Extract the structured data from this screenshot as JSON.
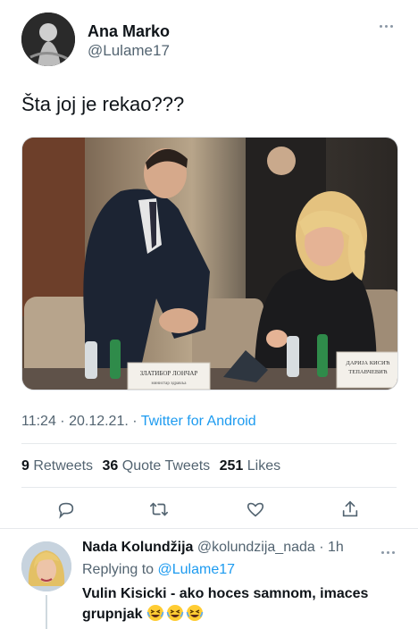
{
  "tweet": {
    "author": {
      "display_name": "Ana Marko",
      "handle": "@Lulame17"
    },
    "text": "Šta joj je rekao???",
    "image_nameplates": {
      "left": [
        "ЗЛАТИБОР ЛОНЧАР",
        "министар здравља"
      ],
      "right": [
        "ДАРИЈА КИСИЋ",
        "ТЕПАВЧЕВИЋ"
      ]
    },
    "time": "11:24 · 20.12.21. · ",
    "source": "Twitter for Android",
    "stats": {
      "retweets_count": "9",
      "retweets_label": " Retweets",
      "quotes_count": "36",
      "quotes_label": " Quote Tweets",
      "likes_count": "251",
      "likes_label": " Likes"
    },
    "actions": [
      "reply-icon",
      "retweet-icon",
      "like-icon",
      "share-icon"
    ]
  },
  "reply": {
    "display_name": "Nada Kolundžija",
    "handle": " @kolundzija_nada · 1h",
    "replying_label": "Replying to ",
    "replying_to": "@Lulame17",
    "text": "Vulin Kisicki - ako hoces samnom, imaces grupnjak",
    "emojis": [
      "laughing-face-emoji",
      "laughing-face-emoji",
      "laughing-face-emoji"
    ]
  },
  "colors": {
    "link": "#1d9bf0",
    "secondary_text": "#536471",
    "primary_text": "#0f1419",
    "divider": "#e6e9ec"
  }
}
